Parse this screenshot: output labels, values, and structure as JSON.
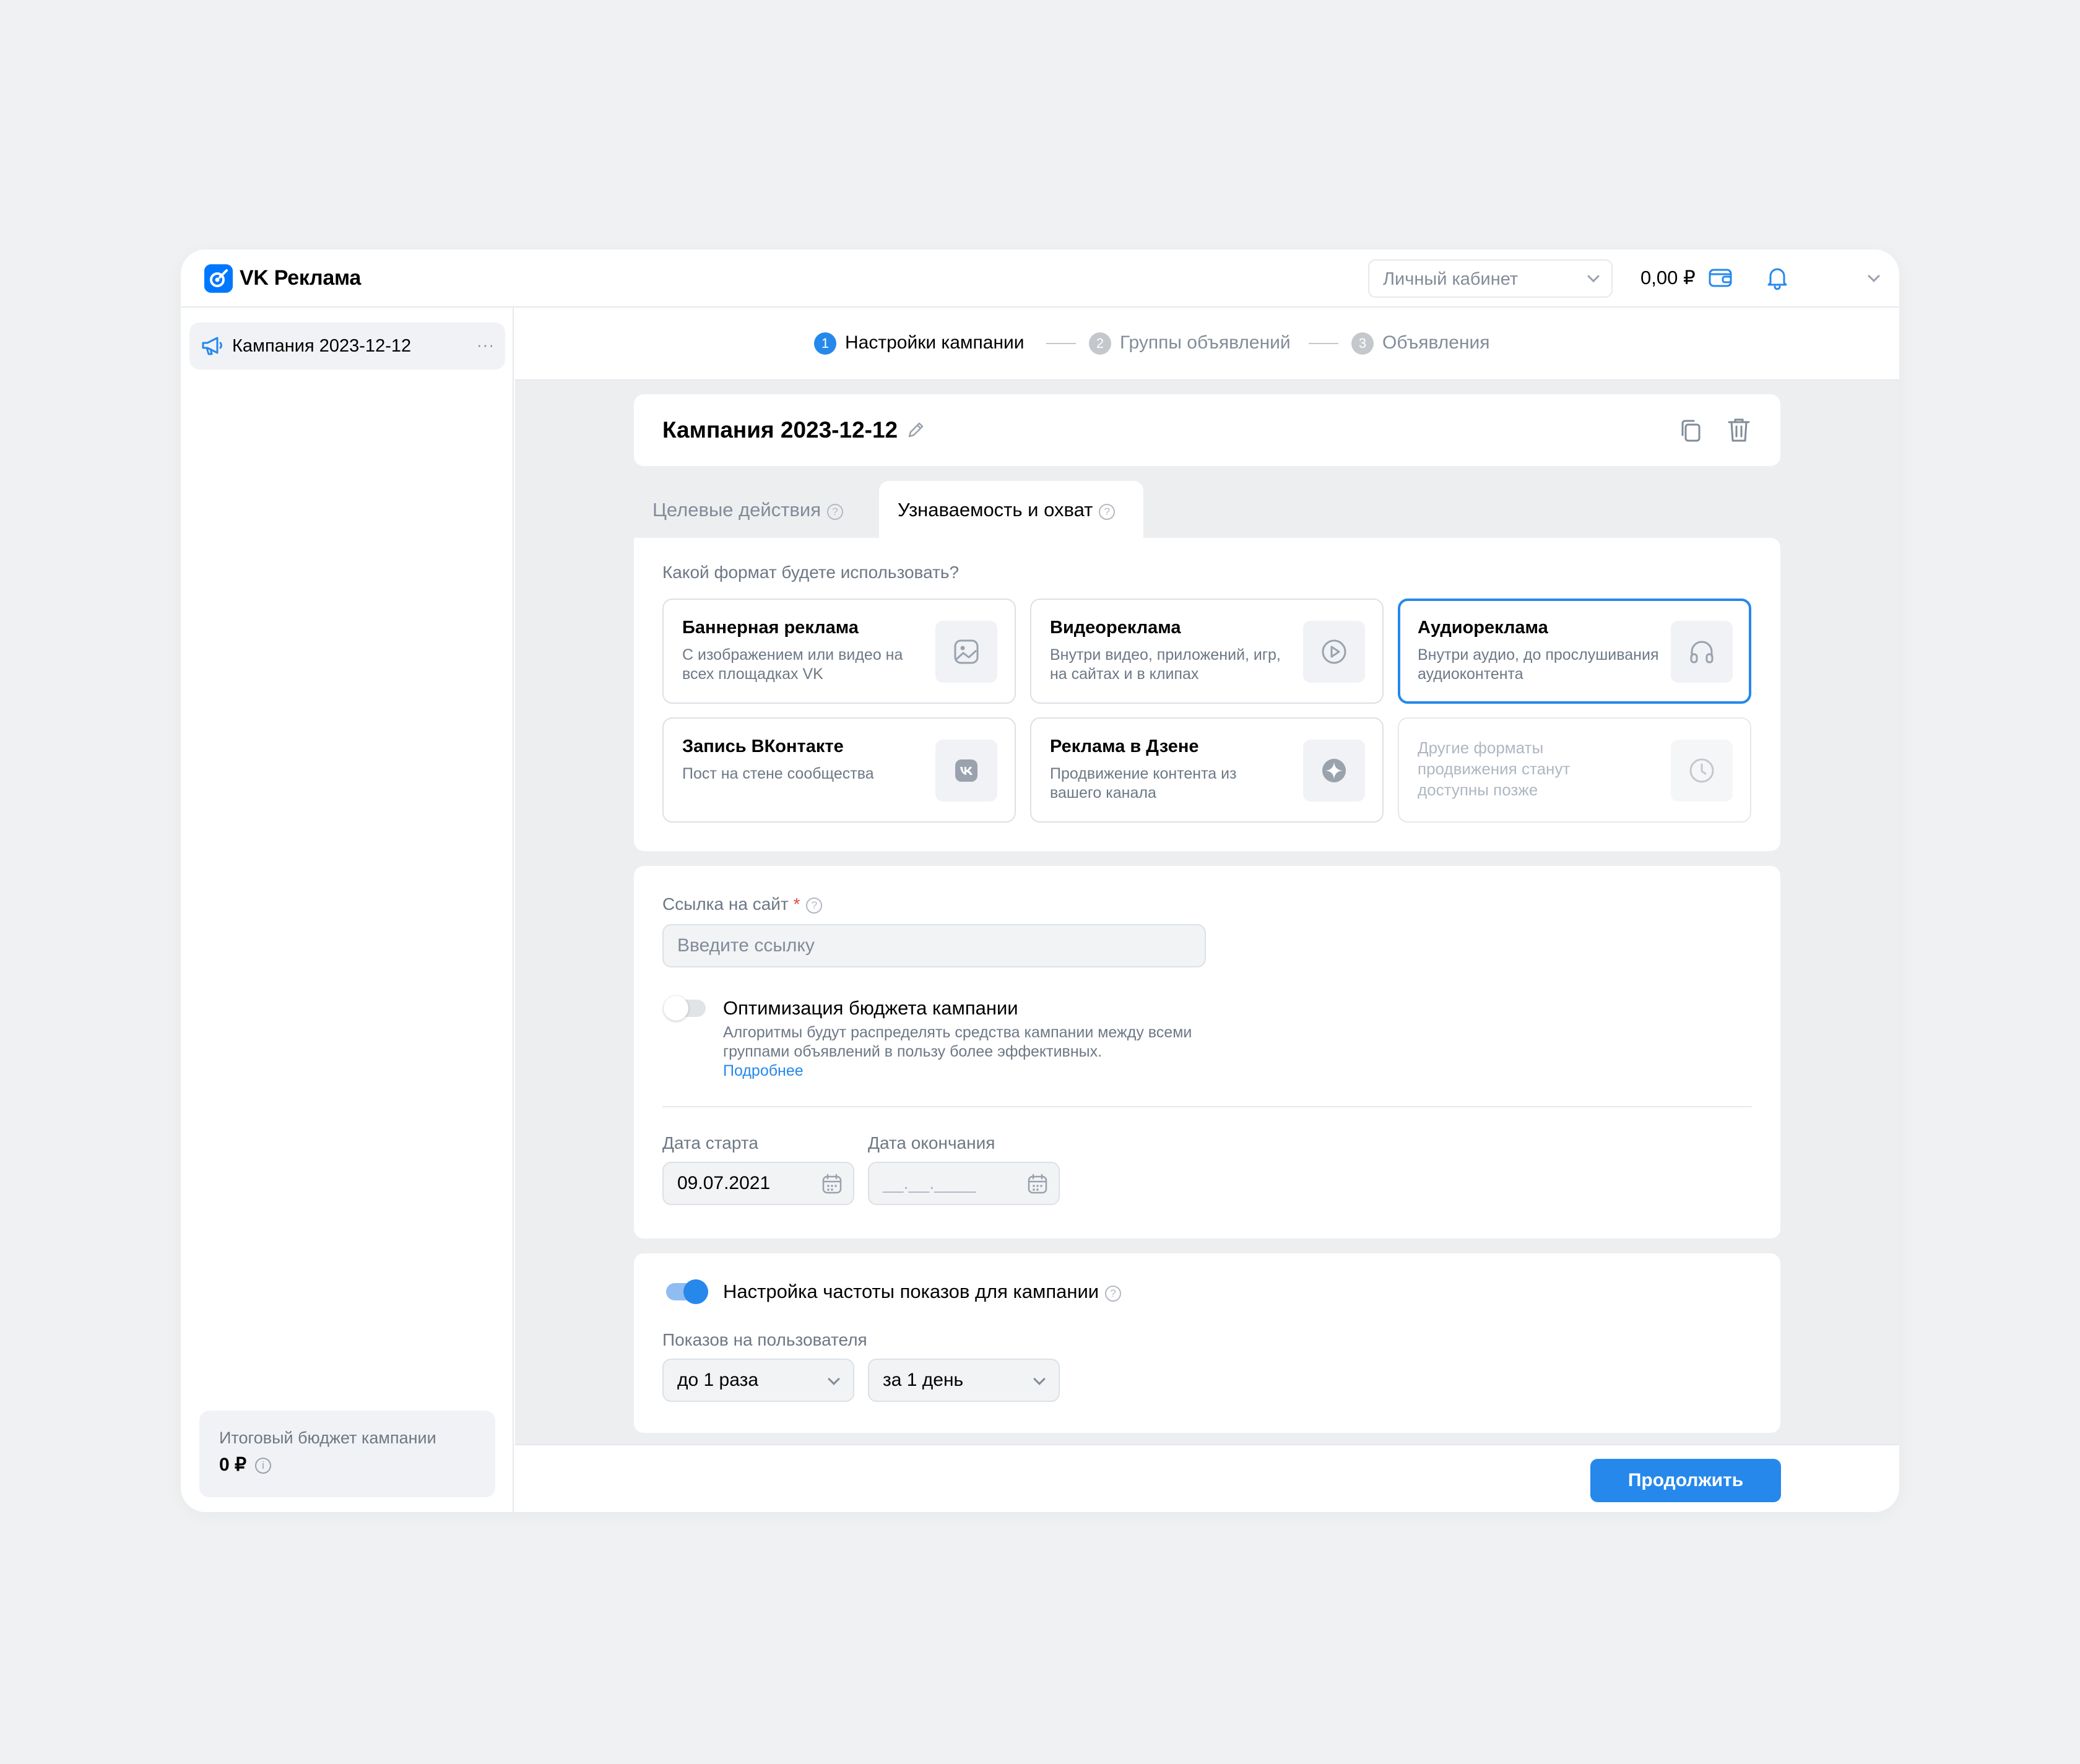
{
  "app": {
    "brand": "VK Реклама",
    "accent": "#2688eb"
  },
  "header": {
    "cabinet": "Личный кабинет",
    "balance": "0,00 ₽"
  },
  "sidebar": {
    "item_label": "Кампания 2023-12-12",
    "more": "···",
    "budget_title": "Итоговый бюджет кампании",
    "budget_value": "0 ₽",
    "budget_info": "i"
  },
  "steps": [
    {
      "num": "1",
      "label": "Настройки кампании",
      "active": true
    },
    {
      "num": "2",
      "label": "Группы объявлений",
      "active": false
    },
    {
      "num": "3",
      "label": "Объявления",
      "active": false
    }
  ],
  "campaign": {
    "title": "Кампания 2023-12-12"
  },
  "tabs": [
    {
      "label": "Целевые действия",
      "active": false
    },
    {
      "label": "Узнаваемость и охват",
      "active": true
    }
  ],
  "formats": {
    "question": "Какой формат будете использовать?",
    "items": [
      {
        "title": "Баннерная реклама",
        "desc": "С изображением или видео на всех площадках VK",
        "icon": "image-icon"
      },
      {
        "title": "Видеореклама",
        "desc": "Внутри видео, приложений, игр, на сайтах и в клипах",
        "icon": "play-icon"
      },
      {
        "title": "Аудиореклама",
        "desc": "Внутри аудио, до прослушивания аудиоконтента",
        "icon": "headphones-icon",
        "selected": true
      },
      {
        "title": "Запись ВКонтакте",
        "desc": "Пост на стене сообщества",
        "icon": "vk-icon"
      },
      {
        "title": "Реклама в Дзене",
        "desc": "Продвижение контента из вашего канала",
        "icon": "zen-icon"
      },
      {
        "title": "",
        "desc": "Другие форматы продвижения станут доступны позже",
        "icon": "clock-icon",
        "disabled": true
      }
    ]
  },
  "settings": {
    "link_label": "Ссылка на сайт",
    "link_required": "*",
    "link_placeholder": "Введите ссылку",
    "budget_opt_title": "Оптимизация бюджета кампании",
    "budget_opt_desc": "Алгоритмы будут распределять средства кампании между всеми группами объявлений в пользу более эффективных.",
    "budget_opt_link": "Подробнее",
    "budget_opt_enabled": false,
    "start_label": "Дата старта",
    "start_value": "09.07.2021",
    "end_label": "Дата окончания",
    "end_placeholder": "__.__.____"
  },
  "frequency": {
    "title": "Настройка частоты показов для кампании",
    "enabled": true,
    "per_user_label": "Показов на пользователя",
    "count_value": "до 1 раза",
    "period_value": "за 1 день"
  },
  "footer": {
    "continue_label": "Продолжить"
  }
}
